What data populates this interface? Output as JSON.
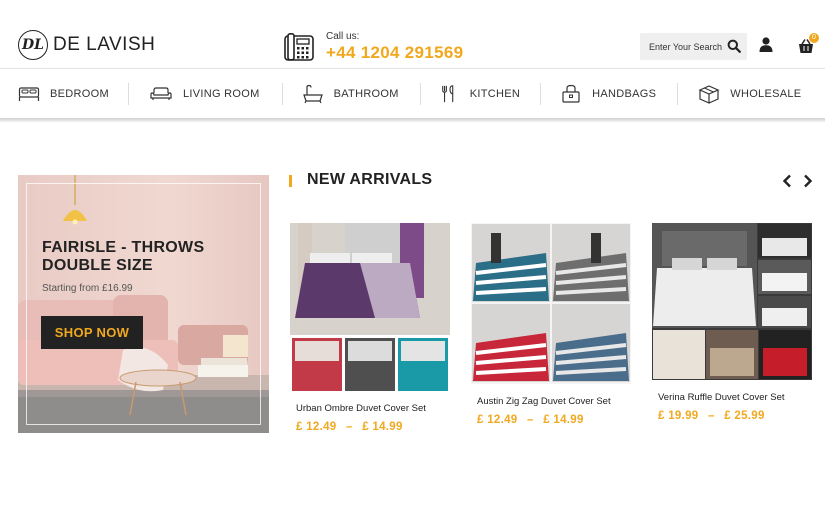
{
  "header": {
    "logo_mark": "DL",
    "logo_text": "DE LAVISH",
    "call_label": "Call us:",
    "phone": "+44 1204 291569",
    "search_placeholder": "Enter Your Search",
    "cart_count": "0"
  },
  "nav": {
    "items": [
      {
        "label": "BEDROOM",
        "icon": "bed-icon"
      },
      {
        "label": "LIVING ROOM",
        "icon": "sofa-icon"
      },
      {
        "label": "BATHROOM",
        "icon": "bathtub-icon"
      },
      {
        "label": "KITCHEN",
        "icon": "cutlery-icon"
      },
      {
        "label": "HANDBAGS",
        "icon": "handbag-icon"
      },
      {
        "label": "WHOLESALE",
        "icon": "box-icon"
      }
    ]
  },
  "banner": {
    "title": "FAIRISLE - THROWS DOUBLE SIZE",
    "subtitle": "Starting from £16.99",
    "button": "SHOP NOW"
  },
  "section": {
    "title": "NEW ARRIVALS"
  },
  "products": [
    {
      "name": "Urban Ombre Duvet Cover Set",
      "price_from": "£ 12.49",
      "price_sep": "–",
      "price_to": "£ 14.99"
    },
    {
      "name": "Austin Zig Zag Duvet Cover Set",
      "price_from": "£ 12.49",
      "price_sep": "–",
      "price_to": "£ 14.99"
    },
    {
      "name": "Verina Ruffle Duvet Cover Set",
      "price_from": "£ 19.99",
      "price_sep": "–",
      "price_to": "£ 25.99"
    }
  ],
  "colors": {
    "accent": "#f0a81e",
    "dark": "#222222"
  }
}
